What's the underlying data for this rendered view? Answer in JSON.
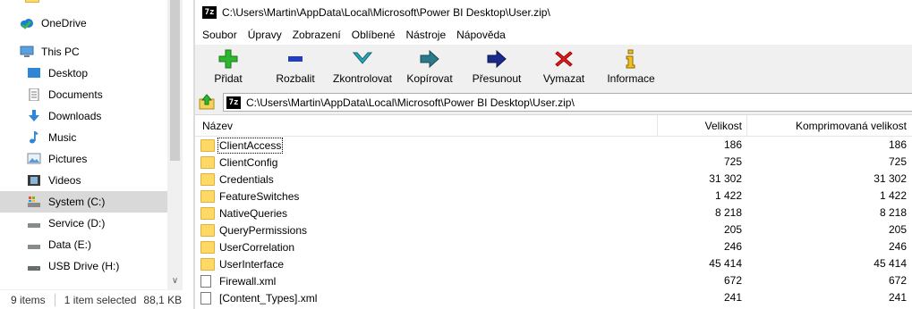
{
  "explorer": {
    "nav_items": [
      {
        "label": "OneDrive",
        "icon": "onedrive-icon",
        "indent": 0
      },
      {
        "label": "This PC",
        "icon": "this-pc-icon",
        "indent": 0
      },
      {
        "label": "Desktop",
        "icon": "desktop-icon",
        "indent": 1
      },
      {
        "label": "Documents",
        "icon": "documents-icon",
        "indent": 1
      },
      {
        "label": "Downloads",
        "icon": "downloads-icon",
        "indent": 1
      },
      {
        "label": "Music",
        "icon": "music-icon",
        "indent": 1
      },
      {
        "label": "Pictures",
        "icon": "pictures-icon",
        "indent": 1
      },
      {
        "label": "Videos",
        "icon": "videos-icon",
        "indent": 1
      },
      {
        "label": "System (C:)",
        "icon": "system-drive-icon",
        "indent": 1,
        "selected": true
      },
      {
        "label": "Service (D:)",
        "icon": "drive-icon",
        "indent": 1
      },
      {
        "label": "Data (E:)",
        "icon": "drive-icon",
        "indent": 1
      },
      {
        "label": "USB Drive (H:)",
        "icon": "usb-drive-icon",
        "indent": 1
      }
    ],
    "status": {
      "items_count": "9 items",
      "selected": "1 item selected",
      "size": "88,1 KB"
    }
  },
  "sevenzip": {
    "title": "C:\\Users\\Martin\\AppData\\Local\\Microsoft\\Power BI Desktop\\User.zip\\",
    "app_icon_label": "7z",
    "menu": [
      "Soubor",
      "Úpravy",
      "Zobrazení",
      "Oblíbené",
      "Nástroje",
      "Nápověda"
    ],
    "toolbar": [
      {
        "label": "Přidat",
        "icon": "add-icon"
      },
      {
        "label": "Rozbalit",
        "icon": "extract-icon"
      },
      {
        "label": "Zkontrolovat",
        "icon": "test-icon"
      },
      {
        "label": "Kopírovat",
        "icon": "copy-icon"
      },
      {
        "label": "Přesunout",
        "icon": "move-icon"
      },
      {
        "label": "Vymazat",
        "icon": "delete-icon"
      },
      {
        "label": "Informace",
        "icon": "info-icon"
      }
    ],
    "address": "C:\\Users\\Martin\\AppData\\Local\\Microsoft\\Power BI Desktop\\User.zip\\",
    "columns": {
      "name": "Název",
      "size": "Velikost",
      "packed": "Komprimovaná velikost"
    },
    "rows": [
      {
        "name": "ClientAccess",
        "size": "186",
        "packed": "186",
        "type": "folder",
        "focused": true
      },
      {
        "name": "ClientConfig",
        "size": "725",
        "packed": "725",
        "type": "folder"
      },
      {
        "name": "Credentials",
        "size": "31 302",
        "packed": "31 302",
        "type": "folder"
      },
      {
        "name": "FeatureSwitches",
        "size": "1 422",
        "packed": "1 422",
        "type": "folder"
      },
      {
        "name": "NativeQueries",
        "size": "8 218",
        "packed": "8 218",
        "type": "folder"
      },
      {
        "name": "QueryPermissions",
        "size": "205",
        "packed": "205",
        "type": "folder"
      },
      {
        "name": "UserCorrelation",
        "size": "246",
        "packed": "246",
        "type": "folder"
      },
      {
        "name": "UserInterface",
        "size": "45 414",
        "packed": "45 414",
        "type": "folder"
      },
      {
        "name": "Firewall.xml",
        "size": "672",
        "packed": "672",
        "type": "file"
      },
      {
        "name": "[Content_Types].xml",
        "size": "241",
        "packed": "241",
        "type": "file"
      }
    ]
  },
  "colors": {
    "selection": "#d9d9d9",
    "folder": "#ffd966",
    "add_green": "#2fb52f",
    "extract_blue": "#1f3fbf",
    "test_teal": "#2aa6b8",
    "delete_red": "#e02020",
    "info_yellow": "#f0c020"
  }
}
